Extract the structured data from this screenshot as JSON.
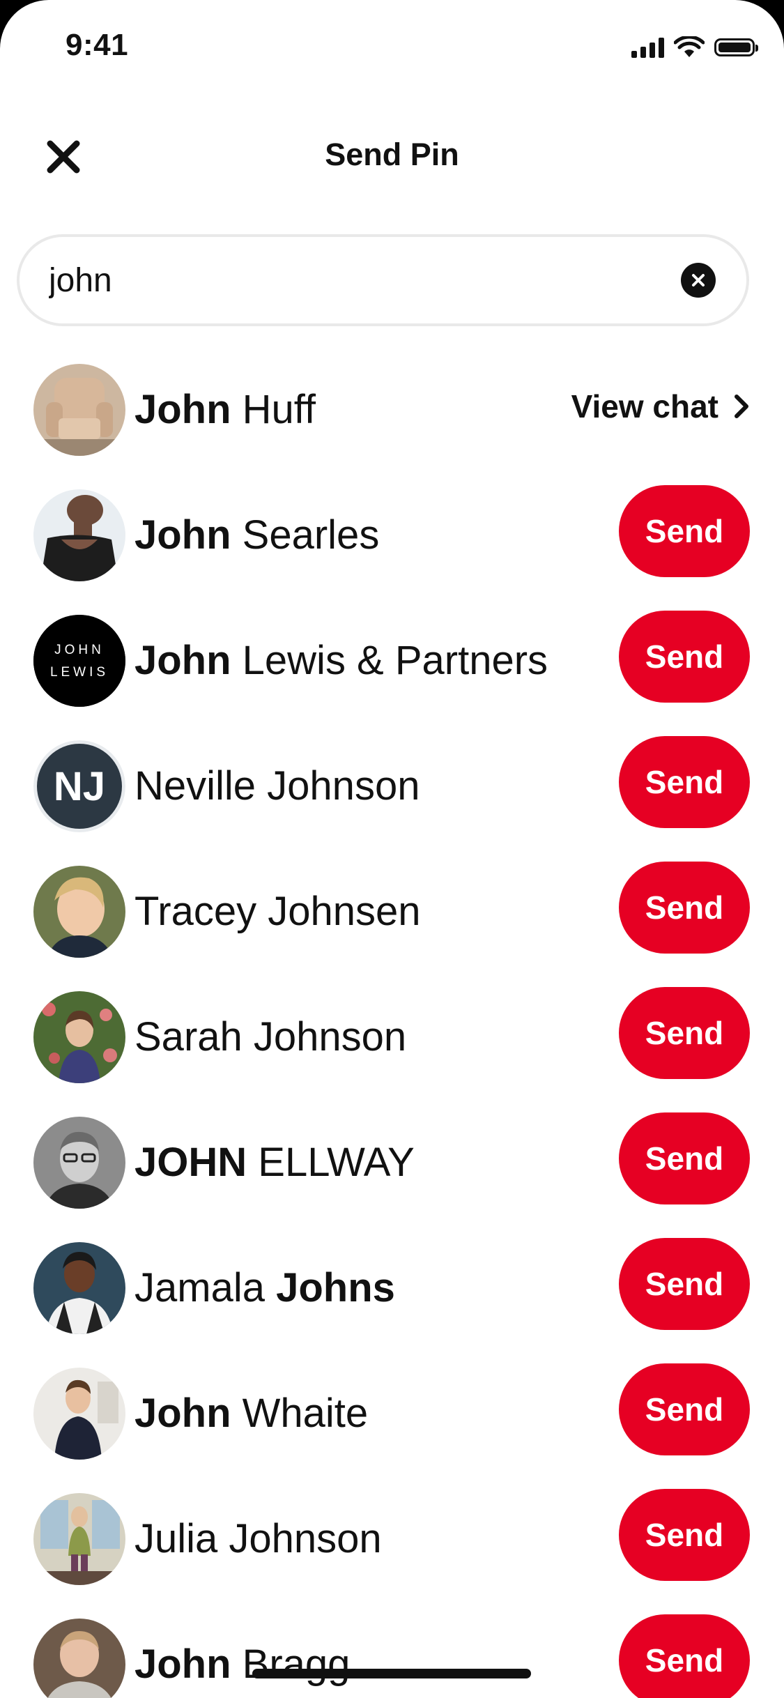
{
  "status_bar": {
    "time": "9:41"
  },
  "header": {
    "title": "Send Pin"
  },
  "search": {
    "value": "john"
  },
  "contacts": [
    {
      "bold": "John",
      "rest": " Huff",
      "action": "view_chat",
      "action_label": "View chat"
    },
    {
      "bold": "John",
      "rest": " Searles",
      "action": "send",
      "action_label": "Send"
    },
    {
      "bold": "John",
      "rest": " Lewis & Partners",
      "action": "send",
      "action_label": "Send",
      "avatar_text_1": "JOHN",
      "avatar_text_2": "LEWIS"
    },
    {
      "prefix": "",
      "bold": "",
      "rest": "Neville Johnson",
      "action": "send",
      "action_label": "Send",
      "avatar_initials": "NJ"
    },
    {
      "bold": "",
      "rest": "Tracey Johnsen",
      "action": "send",
      "action_label": "Send"
    },
    {
      "bold": "",
      "rest": "Sarah Johnson",
      "action": "send",
      "action_label": "Send"
    },
    {
      "bold": "JOHN",
      "rest": " ELLWAY",
      "action": "send",
      "action_label": "Send"
    },
    {
      "prefix": "Jamala ",
      "bold": "Johns",
      "rest": "",
      "action": "send",
      "action_label": "Send"
    },
    {
      "bold": "John",
      "rest": " Whaite",
      "action": "send",
      "action_label": "Send"
    },
    {
      "bold": "",
      "rest": "Julia Johnson",
      "action": "send",
      "action_label": "Send"
    },
    {
      "bold": "John",
      "rest": " Bragg",
      "action": "send",
      "action_label": "Send"
    }
  ],
  "colors": {
    "accent": "#e60023",
    "text": "#111111",
    "search_border": "#e9e9e9"
  }
}
